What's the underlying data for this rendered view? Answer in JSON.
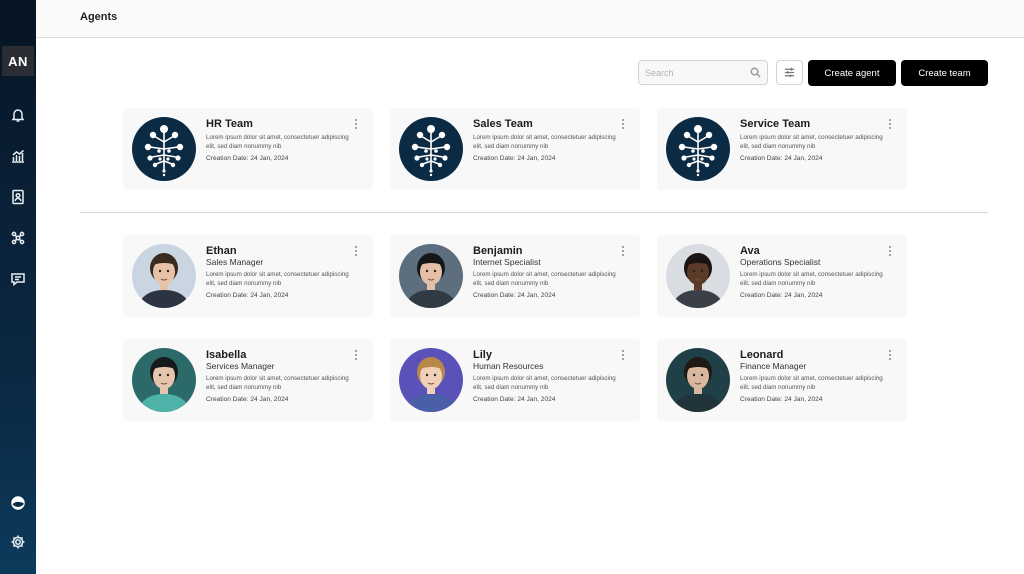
{
  "sidebar": {
    "user_initials": "AN",
    "nav_icons": [
      "bell-icon",
      "chart-icon",
      "contacts-icon",
      "agents-network-icon",
      "chat-icon"
    ],
    "bottom_icons": [
      "theme-toggle-icon",
      "gear-icon"
    ]
  },
  "header": {
    "title": "Agents"
  },
  "toolbar": {
    "search_placeholder": "Search",
    "create_agent_label": "Create agent",
    "create_team_label": "Create team"
  },
  "teams": [
    {
      "name": "HR Team",
      "description": "Lorem ipsum dolor sit amet, consectetuer adipiscing elit, sed diam nonummy nib",
      "creation": "Creation Date: 24 Jan, 2024"
    },
    {
      "name": "Sales Team",
      "description": "Lorem ipsum dolor sit amet, consectetuer adipiscing elit, sed diam nonummy nib",
      "creation": "Creation Date: 24 Jan, 2024"
    },
    {
      "name": "Service Team",
      "description": "Lorem ipsum dolor sit amet, consectetuer adipiscing elit, sed diam nonummy nib",
      "creation": "Creation Date: 24 Jan, 2024"
    }
  ],
  "agents": [
    {
      "name": "Ethan",
      "role": "Sales Manager",
      "description": "Lorem ipsum dolor sit amet, consectetuer adipiscing elit, sed diam nonummy nib",
      "creation": "Creation Date: 24 Jan, 2024",
      "bg": "#c9d6e2",
      "skin": "#e8c2a6",
      "hair": "#3a2a20",
      "suit": "#2b3440"
    },
    {
      "name": "Benjamin",
      "role": "Internet Specialist",
      "description": "Lorem ipsum dolor sit amet, consectetuer adipiscing elit, sed diam nonummy nib",
      "creation": "Creation Date: 24 Jan, 2024",
      "bg": "#5d6f7f",
      "skin": "#e2bfa5",
      "hair": "#141619",
      "suit": "#2f3a44"
    },
    {
      "name": "Ava",
      "role": "Operations Specialist",
      "description": "Lorem ipsum dolor sit amet, consectetuer adipiscing elit, sed diam nonummy nib",
      "creation": "Creation Date: 24 Jan, 2024",
      "bg": "#d9dde2",
      "skin": "#5b3a2a",
      "hair": "#1a1412",
      "suit": "#3b3f47"
    },
    {
      "name": "Isabella",
      "role": "Services Manager",
      "description": "Lorem ipsum dolor sit amet, consectetuer adipiscing elit, sed diam nonummy nib",
      "creation": "Creation Date: 24 Jan, 2024",
      "bg": "#2c6a6a",
      "skin": "#e6c4ad",
      "hair": "#171a1c",
      "suit": "#4fb2a8"
    },
    {
      "name": "Lily",
      "role": "Human Resources",
      "description": "Lorem ipsum dolor sit amet, consectetuer adipiscing elit, sed diam nonummy nib",
      "creation": "Creation Date: 24 Jan, 2024",
      "bg": "#5a52b8",
      "skin": "#efcfb6",
      "hair": "#b8884a",
      "suit": "#4a5fa8"
    },
    {
      "name": "Leonard",
      "role": "Finance Manager",
      "description": "Lorem ipsum dolor sit amet, consectetuer adipiscing elit, sed diam nonummy nib",
      "creation": "Creation Date: 24 Jan, 2024",
      "bg": "#1e4046",
      "skin": "#d8b79e",
      "hair": "#1f1a16",
      "suit": "#20343a"
    }
  ]
}
